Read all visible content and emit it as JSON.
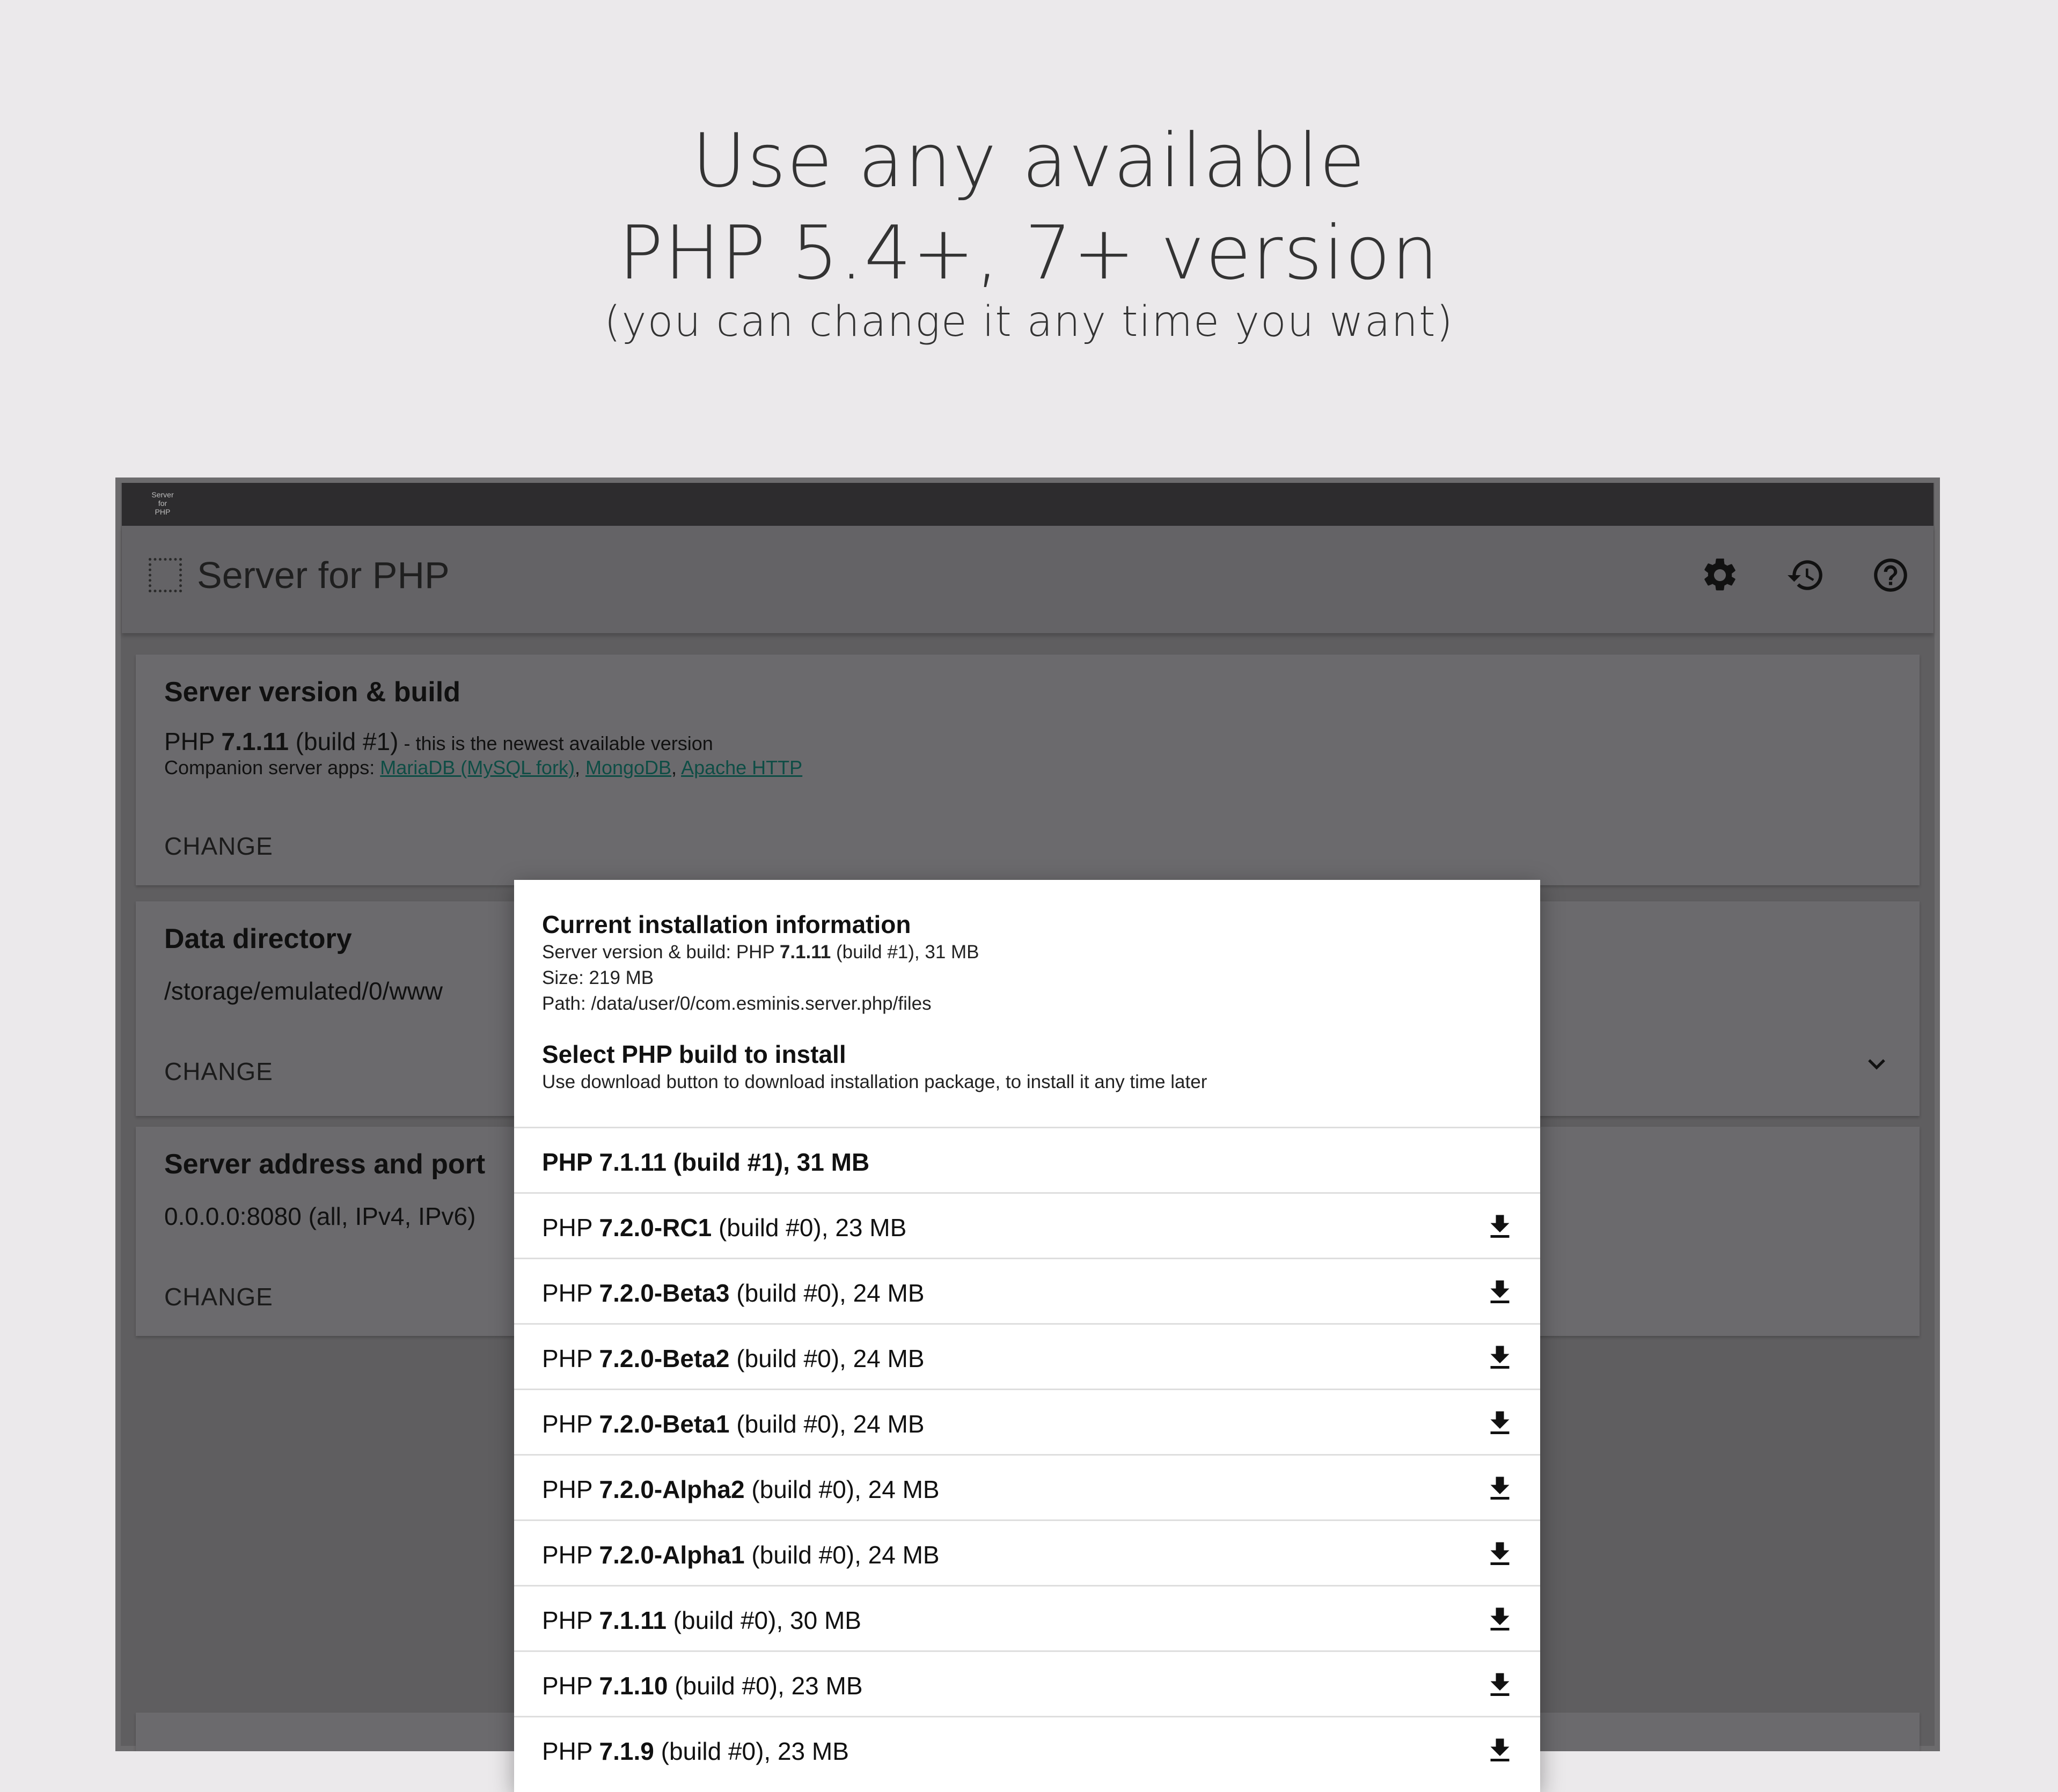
{
  "promo": {
    "line1": "Use any available",
    "line2": "PHP 5.4+, 7+ version",
    "line3": "(you can change it any time you want)"
  },
  "statusbar": {
    "logo": {
      "line1": "Server",
      "line2": "for",
      "line3": "PHP"
    }
  },
  "appbar": {
    "title": "Server for PHP",
    "icons": [
      "settings-gear-icon",
      "history-icon",
      "help-icon"
    ]
  },
  "cards": {
    "server_version": {
      "title": "Server version & build",
      "php_prefix": "PHP ",
      "php_version": "7.1.11",
      "php_build": " (build #1)",
      "newest_note": " - this is the newest available version",
      "companion_prefix": "Companion server apps: ",
      "companion_apps": [
        "MariaDB (MySQL fork)",
        "MongoDB",
        "Apache HTTP"
      ],
      "comma": ", ",
      "change": "CHANGE"
    },
    "data_directory": {
      "title": "Data directory",
      "value": "/storage/emulated/0/www",
      "change": "CHANGE"
    },
    "server_address": {
      "title": "Server address and port",
      "value": "0.0.0.0:8080 (all, IPv4, IPv6)",
      "change": "CHANGE"
    }
  },
  "dialog": {
    "current_title": "Current installation information",
    "current_build_prefix": "Server version & build: PHP ",
    "current_build_version": "7.1.11",
    "current_build_suffix": " (build #1), 31 MB",
    "current_size": "Size: 219 MB",
    "current_path": "Path: /data/user/0/com.esminis.server.php/files",
    "select_title": "Select PHP build to install",
    "select_hint": "Use download button to download installation package, to install it any time later",
    "builds": [
      {
        "prefix": "PHP ",
        "version": "7.1.11",
        "suffix": " (build #1), 31 MB",
        "installed": true
      },
      {
        "prefix": "PHP ",
        "version": "7.2.0-RC1",
        "suffix": " (build #0), 23 MB",
        "installed": false
      },
      {
        "prefix": "PHP ",
        "version": "7.2.0-Beta3",
        "suffix": " (build #0), 24 MB",
        "installed": false
      },
      {
        "prefix": "PHP ",
        "version": "7.2.0-Beta2",
        "suffix": " (build #0), 24 MB",
        "installed": false
      },
      {
        "prefix": "PHP ",
        "version": "7.2.0-Beta1",
        "suffix": " (build #0), 24 MB",
        "installed": false
      },
      {
        "prefix": "PHP ",
        "version": "7.2.0-Alpha2",
        "suffix": " (build #0), 24 MB",
        "installed": false
      },
      {
        "prefix": "PHP ",
        "version": "7.2.0-Alpha1",
        "suffix": " (build #0), 24 MB",
        "installed": false
      },
      {
        "prefix": "PHP ",
        "version": "7.1.11",
        "suffix": " (build #0), 30 MB",
        "installed": false
      },
      {
        "prefix": "PHP ",
        "version": "7.1.10",
        "suffix": " (build #0), 23 MB",
        "installed": false
      },
      {
        "prefix": "PHP ",
        "version": "7.1.9",
        "suffix": " (build #0), 23 MB",
        "installed": false
      }
    ]
  },
  "colors": {
    "background": "#ebe9eb",
    "overlay": "#5f5e60",
    "link": "#0e4d45",
    "dialog": "#ffffff"
  }
}
